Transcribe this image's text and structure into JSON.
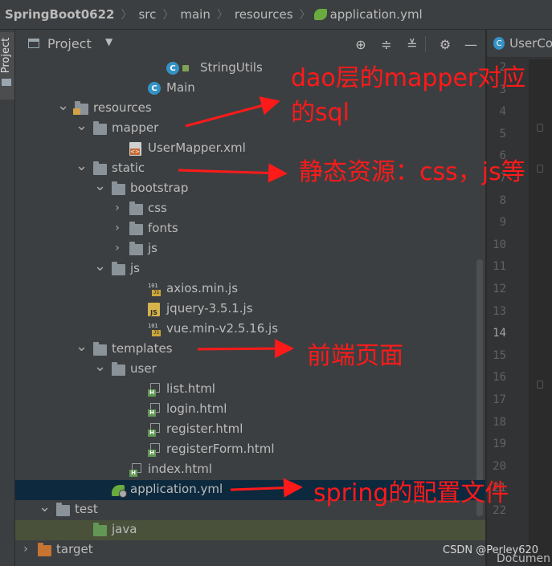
{
  "breadcrumb": [
    "SpringBoot0622",
    "src",
    "main",
    "resources",
    "application.yml"
  ],
  "side_strip": {
    "label": "Project"
  },
  "tool_window": {
    "title": "Project",
    "icons": [
      "locate-icon",
      "expand-all-icon",
      "collapse-all-icon",
      "gear-icon",
      "minimize-icon"
    ]
  },
  "editor": {
    "tab": "UserCo",
    "line_numbers": [
      "2",
      "3",
      "4",
      "5",
      "6",
      "7",
      "8",
      "9",
      "10",
      "11",
      "12",
      "13",
      "14",
      "15",
      "16",
      "17",
      "18",
      "19",
      "20",
      "21",
      "22"
    ],
    "current_line": "14",
    "bottom_text": "Documen"
  },
  "tree": [
    {
      "label": "StringUtils",
      "icon": "class-icon",
      "expanded": null
    },
    {
      "label": "Main",
      "icon": "class-icon",
      "expanded": null
    },
    {
      "label": "resources",
      "icon": "resources-folder-icon",
      "expanded": true
    },
    {
      "label": "mapper",
      "icon": "folder-icon",
      "expanded": true
    },
    {
      "label": "UserMapper.xml",
      "icon": "xml-file-icon",
      "expanded": null
    },
    {
      "label": "static",
      "icon": "folder-icon",
      "expanded": true
    },
    {
      "label": "bootstrap",
      "icon": "folder-icon",
      "expanded": true
    },
    {
      "label": "css",
      "icon": "folder-icon",
      "expanded": false
    },
    {
      "label": "fonts",
      "icon": "folder-icon",
      "expanded": false
    },
    {
      "label": "js",
      "icon": "folder-icon",
      "expanded": false
    },
    {
      "label": "js",
      "icon": "folder-icon",
      "expanded": true
    },
    {
      "label": "axios.min.js",
      "icon": "js-min-file-icon",
      "expanded": null
    },
    {
      "label": "jquery-3.5.1.js",
      "icon": "js-file-icon",
      "expanded": null
    },
    {
      "label": "vue.min-v2.5.16.js",
      "icon": "js-min-file-icon",
      "expanded": null
    },
    {
      "label": "templates",
      "icon": "folder-icon",
      "expanded": true
    },
    {
      "label": "user",
      "icon": "folder-icon",
      "expanded": true
    },
    {
      "label": "list.html",
      "icon": "html-file-icon",
      "expanded": null
    },
    {
      "label": "login.html",
      "icon": "html-file-icon",
      "expanded": null
    },
    {
      "label": "register.html",
      "icon": "html-file-icon",
      "expanded": null
    },
    {
      "label": "registerForm.html",
      "icon": "html-file-icon",
      "expanded": null
    },
    {
      "label": "index.html",
      "icon": "html-file-icon",
      "expanded": null
    },
    {
      "label": "application.yml",
      "icon": "spring-config-icon",
      "expanded": null,
      "selected": true
    },
    {
      "label": "test",
      "icon": "folder-icon",
      "expanded": true
    },
    {
      "label": "java",
      "icon": "test-source-folder-icon",
      "expanded": null
    },
    {
      "label": "target",
      "icon": "excluded-folder-icon",
      "expanded": false
    }
  ],
  "annotations": [
    {
      "line1": "dao层的mapper对应",
      "line2": "的sql"
    },
    {
      "line1": "静态资源：css，js等"
    },
    {
      "line1": "前端页面"
    },
    {
      "line1": "spring的配置文件"
    }
  ],
  "colors": {
    "annotation": "#ff1a1a",
    "background": "#3c3f41",
    "selection": "#0d293e",
    "test_folder_highlight": "#49513a"
  },
  "watermark": "CSDN @Perley620"
}
